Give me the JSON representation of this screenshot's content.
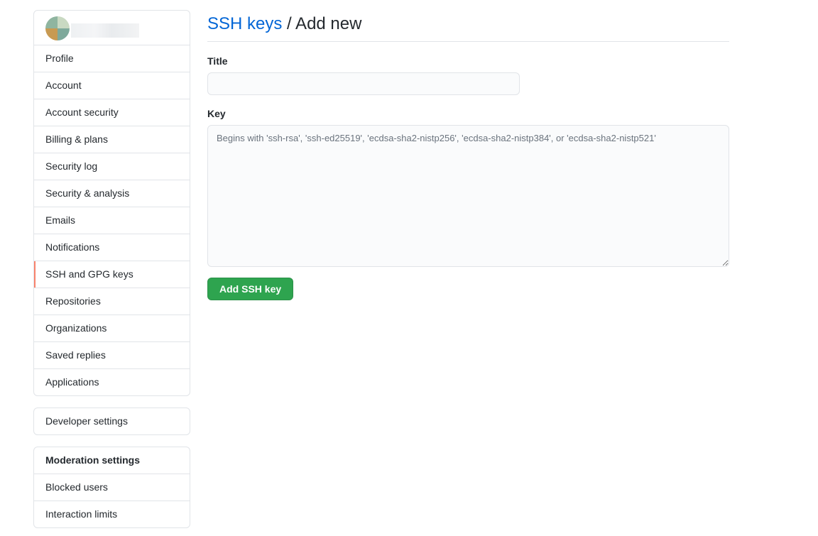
{
  "sidebar": {
    "main_items": [
      {
        "label": "Profile"
      },
      {
        "label": "Account"
      },
      {
        "label": "Account security"
      },
      {
        "label": "Billing & plans"
      },
      {
        "label": "Security log"
      },
      {
        "label": "Security & analysis"
      },
      {
        "label": "Emails"
      },
      {
        "label": "Notifications"
      },
      {
        "label": "SSH and GPG keys",
        "selected": true
      },
      {
        "label": "Repositories"
      },
      {
        "label": "Organizations"
      },
      {
        "label": "Saved replies"
      },
      {
        "label": "Applications"
      }
    ],
    "developer_settings": "Developer settings",
    "moderation": {
      "heading": "Moderation settings",
      "items": [
        {
          "label": "Blocked users"
        },
        {
          "label": "Interaction limits"
        }
      ]
    }
  },
  "main": {
    "breadcrumb_link": "SSH keys",
    "breadcrumb_rest": " / Add new",
    "title_label": "Title",
    "title_value": "",
    "key_label": "Key",
    "key_placeholder": "Begins with 'ssh-rsa', 'ssh-ed25519', 'ecdsa-sha2-nistp256', 'ecdsa-sha2-nistp384', or 'ecdsa-sha2-nistp521'",
    "submit_label": "Add SSH key"
  },
  "colors": {
    "link": "#0366d6",
    "primary_button": "#2ea44f",
    "selected_indicator": "#f9826c"
  }
}
